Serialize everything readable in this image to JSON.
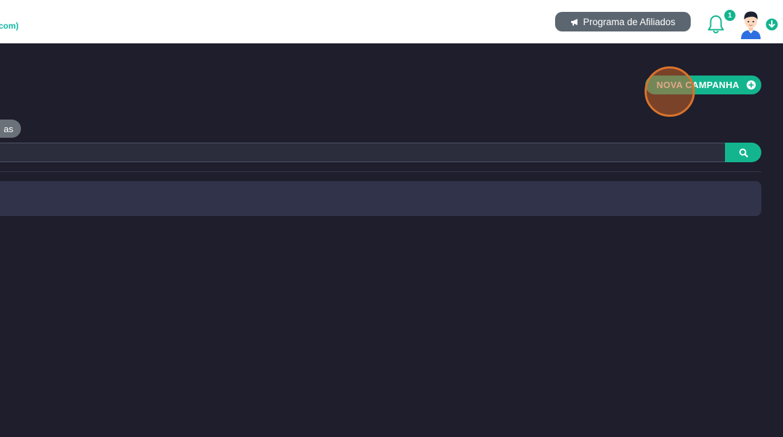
{
  "header": {
    "account_text": "com)",
    "affiliate_button_label": "Programa de Afiliados",
    "affiliate_icon": "megaphone-icon",
    "notifications": {
      "icon": "bell-icon",
      "count": "1"
    },
    "avatar_icon": "user-avatar",
    "menu_icon": "chevron-down-circle-icon"
  },
  "main": {
    "new_campaign_label": "NOVA CAMPANHA",
    "new_campaign_icon": "plus-circle-icon",
    "filter_pill_label": "as",
    "search": {
      "value": "",
      "placeholder": "",
      "button_icon": "search-icon"
    }
  },
  "colors": {
    "accent": "#13b58f",
    "background": "#1e1e2c",
    "header_background": "#ffffff",
    "panel": "#303349",
    "click_marker": "#d9732c"
  }
}
